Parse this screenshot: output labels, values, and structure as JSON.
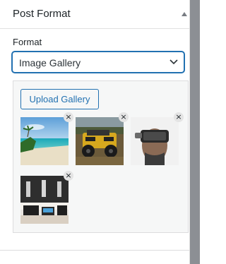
{
  "panel": {
    "title": "Post Format",
    "toggle_icon": "triangle-up-icon"
  },
  "format": {
    "label": "Format",
    "selected": "Image Gallery",
    "chevron_icon": "chevron-down-icon"
  },
  "gallery": {
    "upload_label": "Upload Gallery",
    "remove_glyph": "×",
    "images": [
      {
        "subject": "tropical beach"
      },
      {
        "subject": "off-road jeep"
      },
      {
        "subject": "person with VR headset"
      },
      {
        "subject": "laptops on desk"
      }
    ]
  },
  "colors": {
    "accent": "#2271b1",
    "text": "#1d2327",
    "box_bg": "#f6f7f7",
    "scrollbar": "#8c8f94"
  }
}
